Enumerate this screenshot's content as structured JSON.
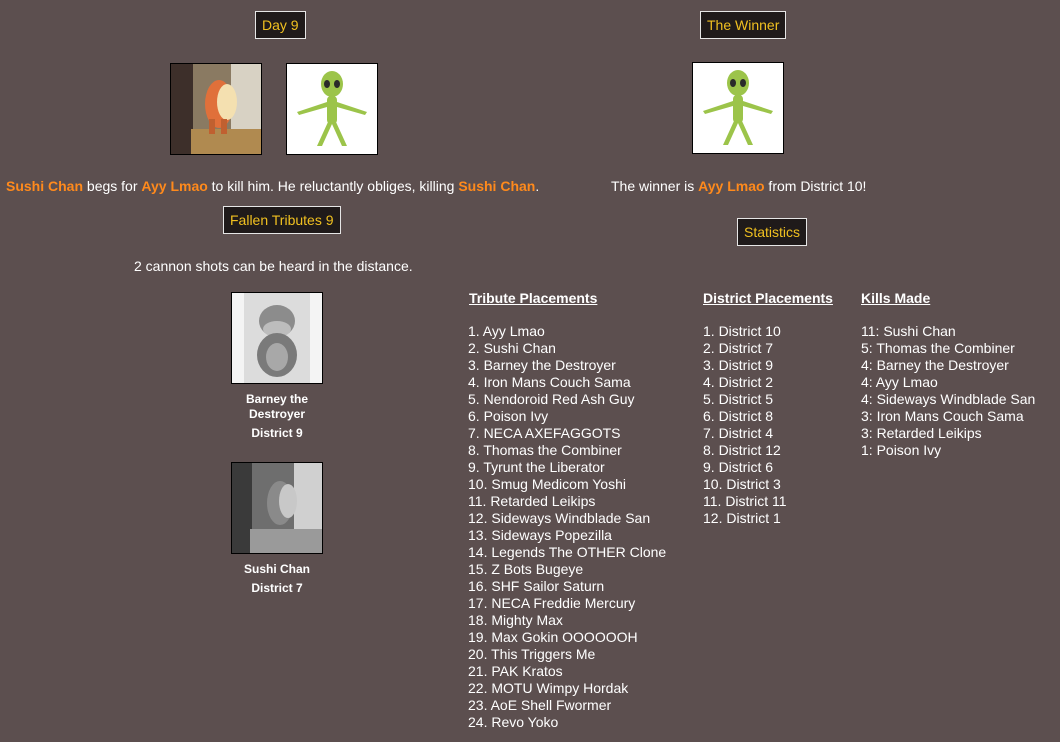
{
  "day": {
    "header": "Day 9",
    "event_victim": "Sushi Chan",
    "event_mid1": " begs for ",
    "event_killer": "Ayy Lmao",
    "event_mid2": " to kill him. He reluctantly obliges, killing ",
    "event_victim2": "Sushi Chan",
    "event_end": "."
  },
  "winner": {
    "header": "The Winner",
    "text_pre": "The winner is ",
    "name": "Ayy Lmao",
    "text_post": " from District 10!"
  },
  "fallen": {
    "header": "Fallen Tributes 9",
    "cannon_text": "2 cannon shots can be heard in the distance.",
    "tributes": [
      {
        "name": "Barney the Destroyer",
        "district": "District 9"
      },
      {
        "name": "Sushi Chan",
        "district": "District 7"
      }
    ]
  },
  "statistics": {
    "header": "Statistics",
    "tribute_title": "Tribute Placements",
    "tribute_placements": [
      "1. Ayy Lmao",
      "2. Sushi Chan",
      "3. Barney the Destroyer",
      "4. Iron Mans Couch Sama",
      "5. Nendoroid Red Ash Guy",
      "6. Poison Ivy",
      "7. NECA AXEFAGGOTS",
      "8. Thomas the Combiner",
      "9. Tyrunt the Liberator",
      "10. Smug Medicom Yoshi",
      "11. Retarded Leikips",
      "12. Sideways Windblade San",
      "13. Sideways Popezilla",
      "14. Legends The OTHER Clone",
      "15. Z Bots Bugeye",
      "16. SHF Sailor Saturn",
      "17. NECA Freddie Mercury",
      "18. Mighty Max",
      "19. Max Gokin OOOOOOH",
      "20. This Triggers Me",
      "21. PAK Kratos",
      "22. MOTU Wimpy Hordak",
      "23. AoE Shell Fwormer",
      "24. Revo Yoko"
    ],
    "district_title": "District Placements",
    "district_placements": [
      "1. District 10",
      "2. District 7",
      "3. District 9",
      "4. District 2",
      "5. District 5",
      "6. District 8",
      "7. District 4",
      "8. District 12",
      "9. District 6",
      "10. District 3",
      "11. District 11",
      "12. District 1"
    ],
    "kills_title": "Kills Made",
    "kills": [
      "11: Sushi Chan",
      "5: Thomas the Combiner",
      "4: Barney the Destroyer",
      "4: Ayy Lmao",
      "4: Sideways Windblade San",
      "3: Iron Mans Couch Sama",
      "3: Retarded Leikips",
      "1: Poison Ivy"
    ]
  }
}
